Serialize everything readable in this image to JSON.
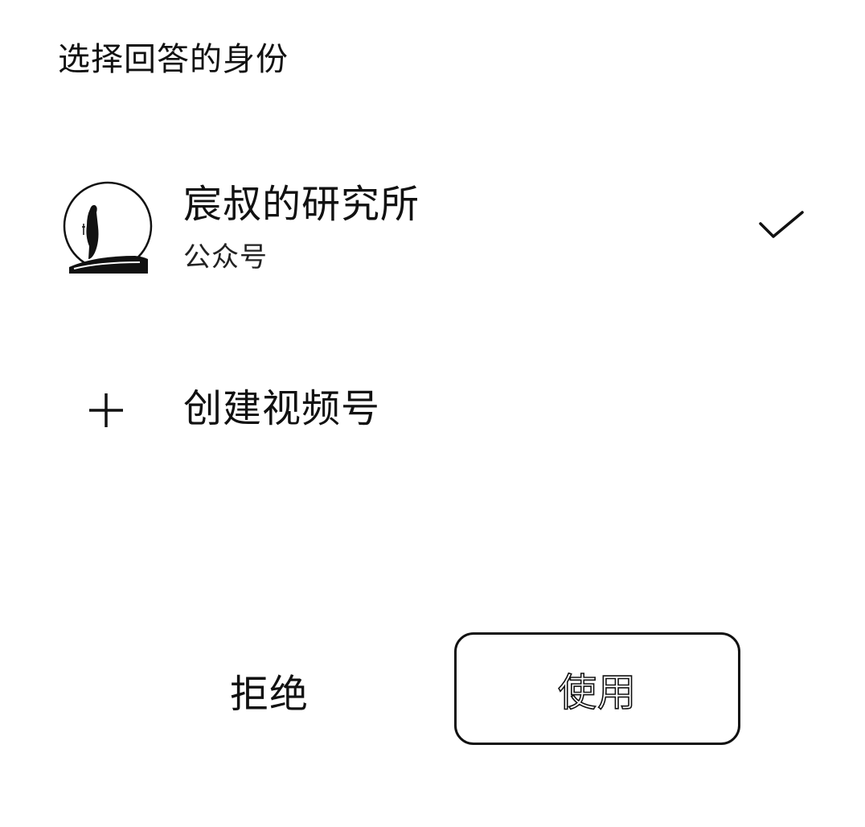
{
  "dialog": {
    "title": "选择回答的身份"
  },
  "account": {
    "name": "宸叔的研究所",
    "type": "公众号",
    "selected": true,
    "avatar_icon": "avatar-silhouette-icon",
    "check_icon": "checkmark-icon"
  },
  "create": {
    "icon": "plus-icon",
    "label": "创建视频号"
  },
  "actions": {
    "reject_label": "拒绝",
    "use_label": "使用"
  },
  "colors": {
    "text": "#111111",
    "background": "#ffffff",
    "border": "#111111"
  }
}
